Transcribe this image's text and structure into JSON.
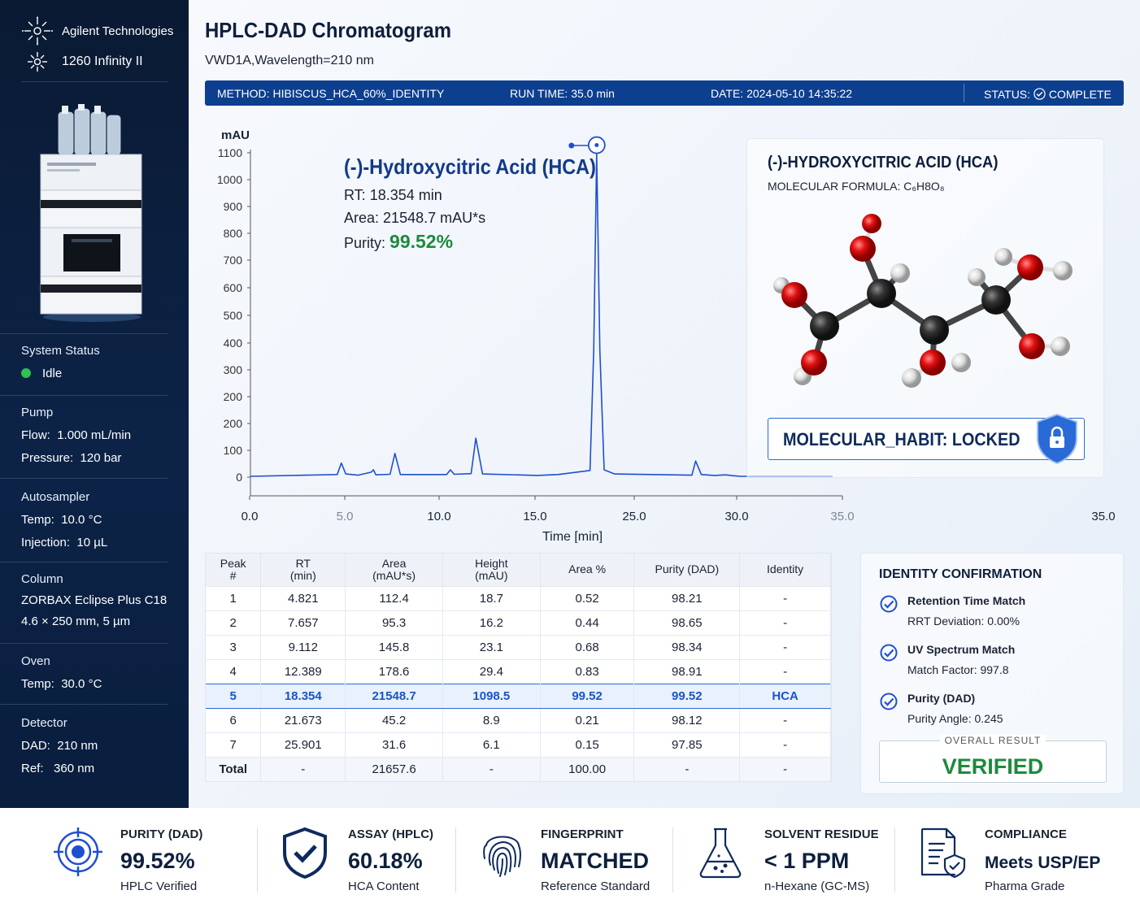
{
  "sidebar": {
    "brand": "Agilent Technologies",
    "model": "1260 Infinity II",
    "system_status": {
      "label": "System Status",
      "value": "Idle"
    },
    "pump": {
      "title": "Pump",
      "flow_label": "Flow:",
      "flow": "1.000 mL/min",
      "pressure_label": "Pressure:",
      "pressure": "120 bar"
    },
    "autosampler": {
      "title": "Autosampler",
      "temp_label": "Temp:",
      "temp": "10.0 °C",
      "injection_label": "Injection:",
      "injection": "10 µL"
    },
    "column": {
      "title": "Column",
      "name": "ZORBAX Eclipse Plus C18",
      "dims": "4.6 × 250 mm, 5 µm"
    },
    "oven": {
      "title": "Oven",
      "temp_label": "Temp:",
      "temp": "30.0 °C"
    },
    "detector": {
      "title": "Detector",
      "dad_label": "DAD:",
      "dad": "210 nm",
      "ref_label": "Ref:",
      "ref": "360 nm"
    }
  },
  "header": {
    "title": "HPLC-DAD Chromatogram",
    "subtitle": "VWD1A,Wavelength=210 nm"
  },
  "runbar": {
    "method_label": "METHOD:",
    "method": "HIBISCUS_HCA_60%_IDENTITY",
    "runtime_label": "RUN TIME:",
    "runtime": "35.0 min",
    "date_label": "DATE:",
    "date": "2024-05-10 14:35:22",
    "status_label": "STATUS:",
    "status": "COMPLETE"
  },
  "peak_annotation": {
    "name": "(-)-Hydroxycitric Acid (HCA)",
    "rt_label": "RT:",
    "rt": "18.354 min",
    "area_label": "Area:",
    "area": "21548.7 mAU*s",
    "purity_label": "Purity:",
    "purity": "99.52%"
  },
  "molecule": {
    "title": "(-)-HYDROXYCITRIC ACID (HCA)",
    "formula_label": "MOLECULAR FORMULA:",
    "formula": "C₆H8O₈",
    "lock_label": "MOLECULAR_HABIT: LOCKED"
  },
  "chart_data": {
    "type": "line",
    "ylabel": "mAU",
    "xlabel": "Time [min]",
    "y_ticks": [
      "1100",
      "1000",
      "900",
      "800",
      "700",
      "600",
      "500",
      "400",
      "300",
      "200",
      "200",
      "100",
      "0"
    ],
    "x_ticks": [
      "0.0",
      "5.0",
      "10.0",
      "15.0",
      "25.0",
      "30.0",
      "35.0",
      "35.0"
    ],
    "x_tick_faint": [
      false,
      true,
      false,
      false,
      false,
      false,
      true,
      false
    ],
    "ylim": [
      0,
      1100
    ],
    "series": [
      {
        "x": [
          0,
          4.6,
          4.82,
          5.05,
          5.7,
          6.4,
          6.52,
          6.65,
          7.4,
          7.66,
          7.95,
          10.4,
          10.6,
          10.8,
          11.7,
          11.95,
          12.3,
          15.2,
          16.3,
          18.0,
          18.2,
          18.354,
          18.52,
          18.75,
          19.3,
          23.4,
          23.6,
          23.9,
          24.6,
          25.2,
          25.6,
          26.0,
          30.0,
          35.0
        ],
        "y": [
          0,
          6,
          45,
          8,
          4,
          14,
          22,
          5,
          7,
          78,
          6,
          6,
          22,
          7,
          9,
          130,
          8,
          3,
          6,
          20,
          430,
          1098.5,
          430,
          22,
          8,
          4,
          52,
          6,
          3,
          5,
          2,
          0,
          0,
          0
        ]
      }
    ],
    "peak_labels": [
      {
        "x": 18.354,
        "y": 1098.5,
        "label": "(-)-Hydroxycitric Acid (HCA)"
      }
    ]
  },
  "table": {
    "headers": [
      [
        "Peak",
        "#"
      ],
      [
        "RT",
        "(min)"
      ],
      [
        "Area",
        "(mAU*s)"
      ],
      [
        "Height",
        "(mAU)"
      ],
      [
        "Area %"
      ],
      [
        "Purity (DAD)"
      ],
      [
        "Identity"
      ]
    ],
    "rows": [
      [
        "1",
        "4.821",
        "112.4",
        "18.7",
        "0.52",
        "98.21",
        "-"
      ],
      [
        "2",
        "7.657",
        "95.3",
        "16.2",
        "0.44",
        "98.65",
        "-"
      ],
      [
        "3",
        "9.112",
        "145.8",
        "23.1",
        "0.68",
        "98.34",
        "-"
      ],
      [
        "4",
        "12.389",
        "178.6",
        "29.4",
        "0.83",
        "98.91",
        "-"
      ],
      [
        "5",
        "18.354",
        "21548.7",
        "1098.5",
        "99.52",
        "99.52",
        "HCA"
      ],
      [
        "6",
        "21.673",
        "45.2",
        "8.9",
        "0.21",
        "98.12",
        "-"
      ],
      [
        "7",
        "25.901",
        "31.6",
        "6.1",
        "0.15",
        "97.85",
        "-"
      ]
    ],
    "highlight_row": 4,
    "total": [
      "Total",
      "-",
      "21657.6",
      "-",
      "100.00",
      "-",
      "-"
    ]
  },
  "identity": {
    "title": "IDENTITY CONFIRMATION",
    "items": [
      {
        "title": "Retention Time Match",
        "detail": "RRT Deviation: 0.00%"
      },
      {
        "title": "UV Spectrum Match",
        "detail": "Match Factor: 997.8"
      },
      {
        "title": "Purity (DAD)",
        "detail": "Purity Angle: 0.245"
      }
    ],
    "overall_label": "OVERALL RESULT",
    "overall_value": "VERIFIED"
  },
  "footer": [
    {
      "label": "PURITY (DAD)",
      "value": "99.52%",
      "sub": "HPLC Verified",
      "icon": "target-icon"
    },
    {
      "label": "ASSAY (HPLC)",
      "value": "60.18%",
      "sub": "HCA Content",
      "icon": "shield-check-icon"
    },
    {
      "label": "FINGERPRINT",
      "value": "MATCHED",
      "sub": "Reference Standard",
      "icon": "fingerprint-icon"
    },
    {
      "label": "SOLVENT RESIDUE",
      "value": "< 1 PPM",
      "sub": "n-Hexane (GC-MS)",
      "icon": "flask-icon"
    },
    {
      "label": "COMPLIANCE",
      "value": "Meets USP/EP",
      "sub": "Pharma Grade",
      "icon": "document-check-icon"
    }
  ],
  "colors": {
    "accent": "#0d3f8f",
    "trace": "#1f4fd0",
    "success": "#1d8a3d",
    "sidebar": "#0a1a33"
  }
}
